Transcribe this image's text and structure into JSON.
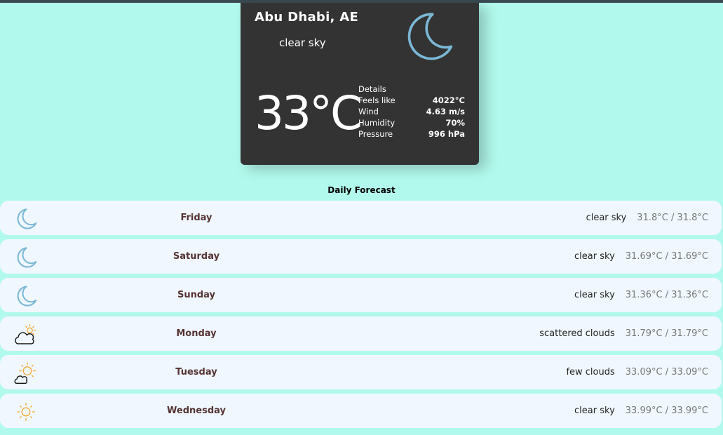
{
  "current": {
    "city": "Abu Dhabi, AE",
    "description": "clear sky",
    "temperature": "33°C",
    "icon": "crescent-moon-icon",
    "details_heading": "Details",
    "details": [
      {
        "label": "Feels like",
        "value": "4022°C"
      },
      {
        "label": "Wind",
        "value": "4.63 m/s"
      },
      {
        "label": "Humidity",
        "value": "70%"
      },
      {
        "label": "Pressure",
        "value": "996 hPa"
      }
    ]
  },
  "forecast": {
    "title": "Daily Forecast",
    "days": [
      {
        "day": "Friday",
        "description": "clear sky",
        "temps": "31.8°C / 31.8°C",
        "icon": "crescent-moon-icon"
      },
      {
        "day": "Saturday",
        "description": "clear sky",
        "temps": "31.69°C / 31.69°C",
        "icon": "crescent-moon-icon"
      },
      {
        "day": "Sunday",
        "description": "clear sky",
        "temps": "31.36°C / 31.36°C",
        "icon": "crescent-moon-icon"
      },
      {
        "day": "Monday",
        "description": "scattered clouds",
        "temps": "31.79°C / 31.79°C",
        "icon": "cloud-sun-icon"
      },
      {
        "day": "Tuesday",
        "description": "few clouds",
        "temps": "33.09°C / 33.09°C",
        "icon": "sun-cloud-icon"
      },
      {
        "day": "Wednesday",
        "description": "clear sky",
        "temps": "33.99°C / 33.99°C",
        "icon": "sun-icon"
      }
    ]
  },
  "colors": {
    "page_background": "#b1f9ec",
    "card_background": "#333333",
    "row_background": "#f0f7fe",
    "moon": "#7bb8d6",
    "sun": "#f2a93b",
    "day_text": "#553333"
  }
}
